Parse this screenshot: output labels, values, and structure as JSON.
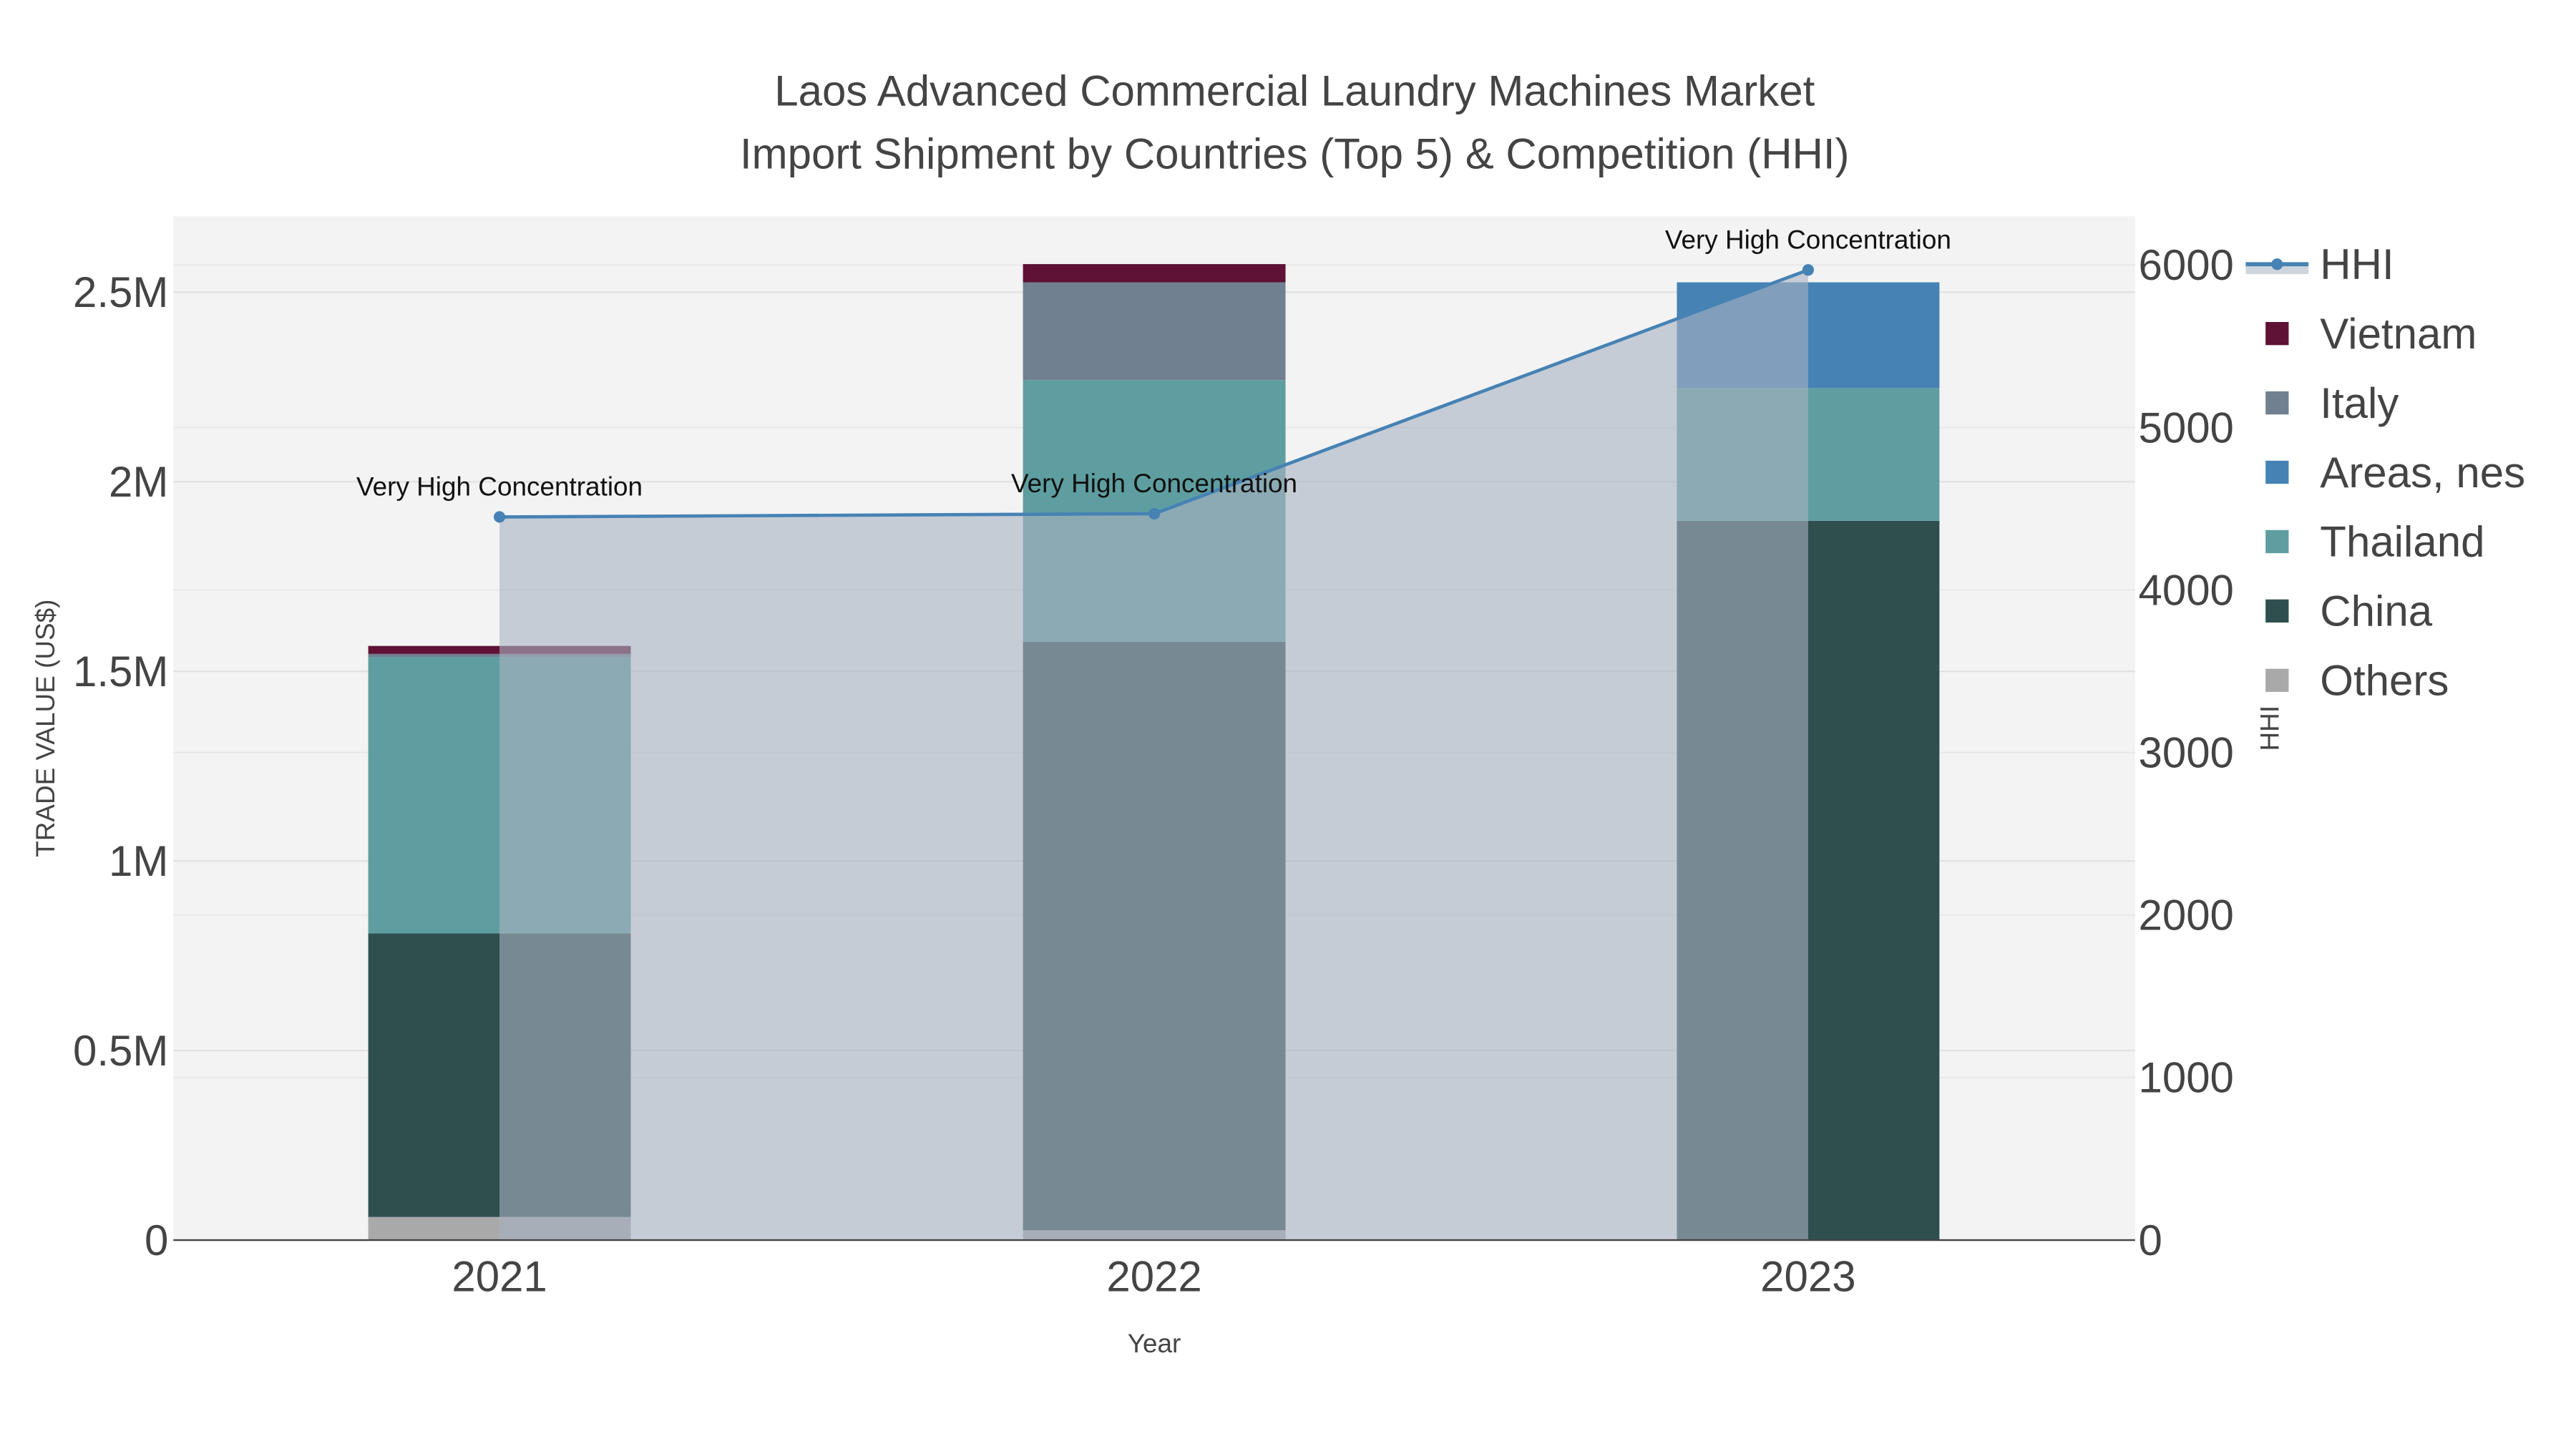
{
  "chart_data": {
    "type": "bar",
    "title_line1": "Laos Advanced Commercial Laundry Machines Market",
    "title_line2": "Import Shipment by Countries (Top 5) & Competition (HHI)",
    "xlabel": "Year",
    "ylabel": "TRADE VALUE (US$)",
    "y2label": "HHI",
    "categories": [
      "2021",
      "2022",
      "2023"
    ],
    "ylim": [
      0,
      2700000
    ],
    "y2lim": [
      0,
      6300
    ],
    "yticks": [
      {
        "v": 0,
        "label": "0"
      },
      {
        "v": 500000,
        "label": "0.5M"
      },
      {
        "v": 1000000,
        "label": "1M"
      },
      {
        "v": 1500000,
        "label": "1.5M"
      },
      {
        "v": 2000000,
        "label": "2M"
      },
      {
        "v": 2500000,
        "label": "2.5M"
      }
    ],
    "y2ticks": [
      {
        "v": 0,
        "label": "0"
      },
      {
        "v": 1000,
        "label": "1000"
      },
      {
        "v": 2000,
        "label": "2000"
      },
      {
        "v": 3000,
        "label": "3000"
      },
      {
        "v": 4000,
        "label": "4000"
      },
      {
        "v": 5000,
        "label": "5000"
      },
      {
        "v": 6000,
        "label": "6000"
      }
    ],
    "stack_order": [
      "Others",
      "China",
      "Thailand",
      "Areas, nes",
      "Italy",
      "Vietnam"
    ],
    "series": [
      {
        "name": "Vietnam",
        "color": "#5f1235",
        "values": [
          21000,
          48000,
          0
        ]
      },
      {
        "name": "Italy",
        "color": "#708090",
        "values": [
          8000,
          258000,
          0
        ]
      },
      {
        "name": "Areas, nes",
        "color": "#4682b4",
        "values": [
          0,
          0,
          279000
        ]
      },
      {
        "name": "Thailand",
        "color": "#5f9ea0",
        "values": [
          729000,
          690000,
          350000
        ]
      },
      {
        "name": "China",
        "color": "#2f4f4f",
        "values": [
          748000,
          1552000,
          1897000
        ]
      },
      {
        "name": "Others",
        "color": "#a9a9a9",
        "values": [
          61000,
          26000,
          0
        ]
      }
    ],
    "hhi": {
      "name": "HHI",
      "color": "#4682b4",
      "values": [
        4450,
        4470,
        5970
      ],
      "annotations": [
        "Very High Concentration",
        "Very High Concentration",
        "Very High Concentration"
      ]
    },
    "legend": [
      "HHI",
      "Vietnam",
      "Italy",
      "Areas, nes",
      "Thailand",
      "China",
      "Others"
    ],
    "legend_position": "right"
  }
}
